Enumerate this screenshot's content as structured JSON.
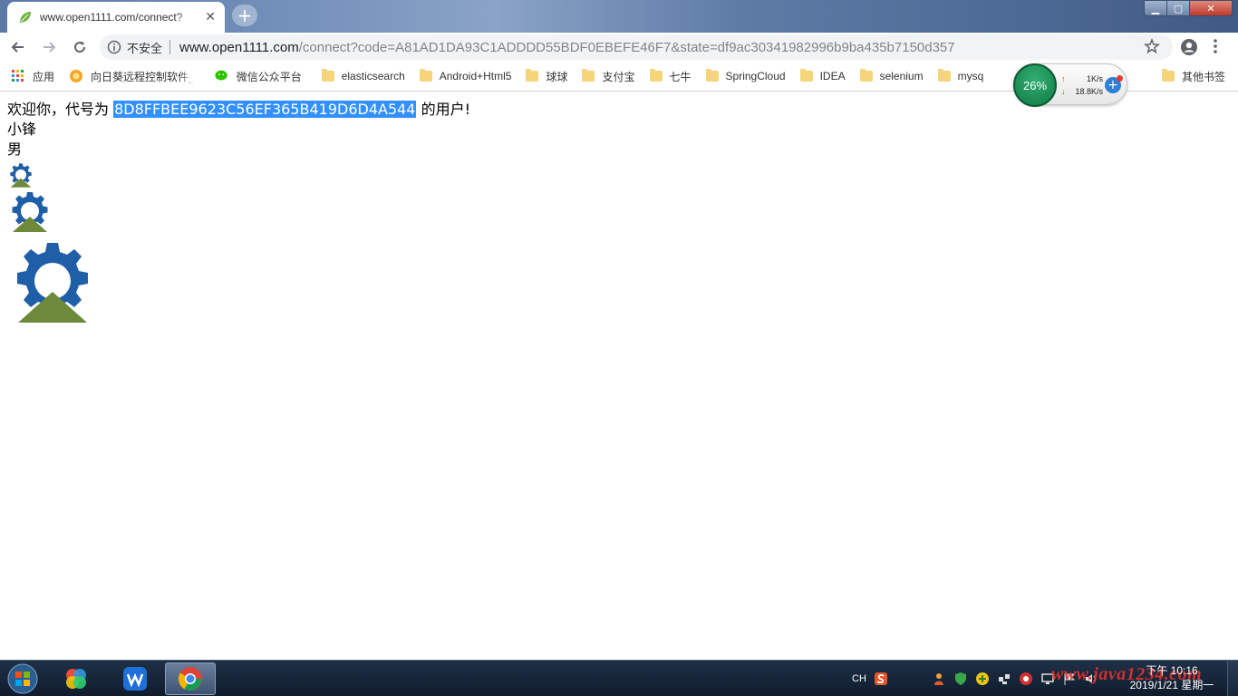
{
  "browser": {
    "tab": {
      "title": "www.open1111.com/connect?",
      "close_glyph": "✕"
    },
    "newtab_glyph": "+",
    "window_controls": {
      "minimize": "▁",
      "maximize": "▢",
      "close": "✕"
    },
    "omnibox": {
      "security_label": "不安全",
      "url_host": "www.open1111.com",
      "url_rest": "/connect?code=A81AD1DA93C1ADDDD55BDF0EBEFE46F7&state=df9ac30341982996b9ba435b7150d357"
    },
    "bookmarks": [
      {
        "label": "应用",
        "icon": "apps-grid-icon"
      },
      {
        "label": "向日葵远程控制软件_",
        "icon": "sunflower-icon"
      },
      {
        "label": "微信公众平台",
        "icon": "wechat-icon"
      },
      {
        "label": "elasticsearch",
        "icon": "folder-icon"
      },
      {
        "label": "Android+Html5",
        "icon": "folder-icon"
      },
      {
        "label": "球球",
        "icon": "folder-icon"
      },
      {
        "label": "支付宝",
        "icon": "folder-icon"
      },
      {
        "label": "七牛",
        "icon": "folder-icon"
      },
      {
        "label": "SpringCloud",
        "icon": "folder-icon"
      },
      {
        "label": "IDEA",
        "icon": "folder-icon"
      },
      {
        "label": "selenium",
        "icon": "folder-icon"
      },
      {
        "label": "mysq",
        "icon": "folder-icon"
      }
    ],
    "other_bookmarks": "其他书签"
  },
  "speed_widget": {
    "percent": "26%",
    "upload": "1K/s",
    "download": "18.8K/s",
    "up_arrow": "↑",
    "down_arrow": "↓",
    "plus": "+"
  },
  "page": {
    "greeting_prefix": "欢迎你，代号为 ",
    "user_code": "8D8FFBEE9623C56EF365B419D6D4A544",
    "greeting_suffix": " 的用户!",
    "nickname": "小锋",
    "gender": "男"
  },
  "taskbar": {
    "tray_lang": "CH",
    "clock_time": "下午 10:16",
    "clock_date": "2019/1/21 星期一",
    "watermark": "www.java1234.com"
  },
  "colors": {
    "selection": "#3390ff",
    "gear_blue": "#1f5fa8",
    "mountain_green": "#6d8a3a"
  }
}
